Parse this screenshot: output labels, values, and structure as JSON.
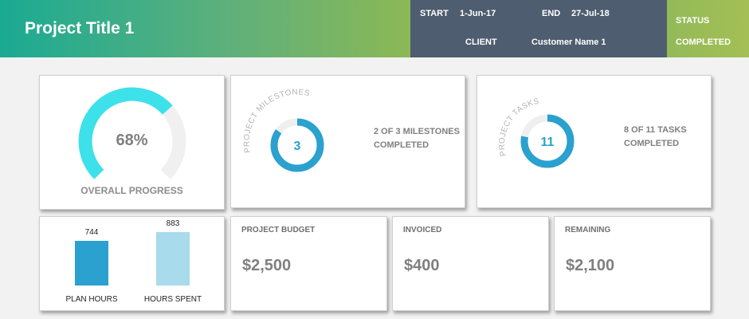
{
  "header": {
    "project_title": "Project Title 1",
    "start_label": "START",
    "start_date": "1-Jun-17",
    "end_label": "END",
    "end_date": "27-Jul-18",
    "client_label": "CLIENT",
    "client_name": "Customer Name 1",
    "status_label": "STATUS",
    "status_value": "COMPLETED"
  },
  "progress": {
    "value_text": "68%",
    "fraction": 0.68,
    "label": "OVERALL PROGRESS",
    "arc_color": "#3de1ea",
    "track_color": "#f0f0f0"
  },
  "milestones": {
    "arc_label": "PROJECT MILESTONES",
    "completed": 3,
    "total": 3,
    "count_text": "3",
    "summary_line1": "2 OF 3 MILESTONES",
    "summary_line2": "COMPLETED",
    "ring_color": "#2aa1cf"
  },
  "tasks": {
    "arc_label": "PROJECT TASKS",
    "completed": 8,
    "total": 11,
    "count_text": "11",
    "summary_line1": "8 OF 11 TASKS",
    "summary_line2": "COMPLETED",
    "ring_color": "#2aa1cf"
  },
  "hours": {
    "chart_data": {
      "type": "bar",
      "categories": [
        "PLAN HOURS",
        "HOURS SPENT"
      ],
      "values": [
        744,
        883
      ],
      "colors": [
        "#2aa1cf",
        "#a8dbeb"
      ]
    },
    "plan_value_text": "744",
    "spent_value_text": "883",
    "plan_label": "PLAN HOURS",
    "spent_label": "HOURS SPENT"
  },
  "finance": {
    "budget_label": "PROJECT BUDGET",
    "budget_value": "$2,500",
    "invoiced_label": "INVOICED",
    "invoiced_value": "$400",
    "remaining_label": "REMAINING",
    "remaining_value": "$2,100"
  }
}
